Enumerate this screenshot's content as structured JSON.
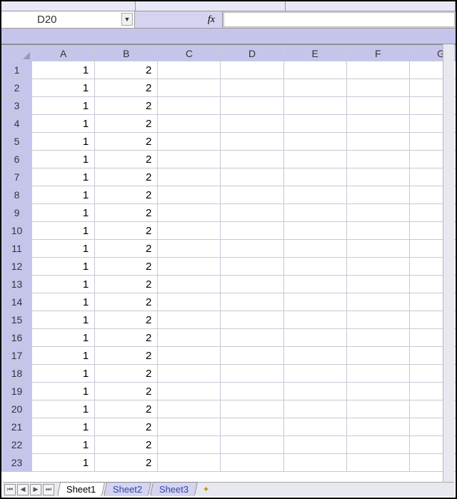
{
  "top_fragments": [
    "",
    "",
    ""
  ],
  "namebox": {
    "value": "D20"
  },
  "fx_label": "fx",
  "formula_value": "",
  "columns": [
    "A",
    "B",
    "C",
    "D",
    "E",
    "F",
    "G"
  ],
  "rows": [
    {
      "n": 1,
      "A": "1",
      "B": "2"
    },
    {
      "n": 2,
      "A": "1",
      "B": "2"
    },
    {
      "n": 3,
      "A": "1",
      "B": "2"
    },
    {
      "n": 4,
      "A": "1",
      "B": "2"
    },
    {
      "n": 5,
      "A": "1",
      "B": "2"
    },
    {
      "n": 6,
      "A": "1",
      "B": "2"
    },
    {
      "n": 7,
      "A": "1",
      "B": "2"
    },
    {
      "n": 8,
      "A": "1",
      "B": "2"
    },
    {
      "n": 9,
      "A": "1",
      "B": "2"
    },
    {
      "n": 10,
      "A": "1",
      "B": "2"
    },
    {
      "n": 11,
      "A": "1",
      "B": "2"
    },
    {
      "n": 12,
      "A": "1",
      "B": "2"
    },
    {
      "n": 13,
      "A": "1",
      "B": "2"
    },
    {
      "n": 14,
      "A": "1",
      "B": "2"
    },
    {
      "n": 15,
      "A": "1",
      "B": "2"
    },
    {
      "n": 16,
      "A": "1",
      "B": "2"
    },
    {
      "n": 17,
      "A": "1",
      "B": "2"
    },
    {
      "n": 18,
      "A": "1",
      "B": "2"
    },
    {
      "n": 19,
      "A": "1",
      "B": "2"
    },
    {
      "n": 20,
      "A": "1",
      "B": "2"
    },
    {
      "n": 21,
      "A": "1",
      "B": "2"
    },
    {
      "n": 22,
      "A": "1",
      "B": "2"
    },
    {
      "n": 23,
      "A": "1",
      "B": "2"
    }
  ],
  "sheet_tabs": [
    {
      "label": "Sheet1",
      "active": true
    },
    {
      "label": "Sheet2",
      "active": false
    },
    {
      "label": "Sheet3",
      "active": false
    }
  ],
  "nav_glyphs": {
    "first": "⏮",
    "prev": "◀",
    "next": "▶",
    "last": "⏭"
  }
}
